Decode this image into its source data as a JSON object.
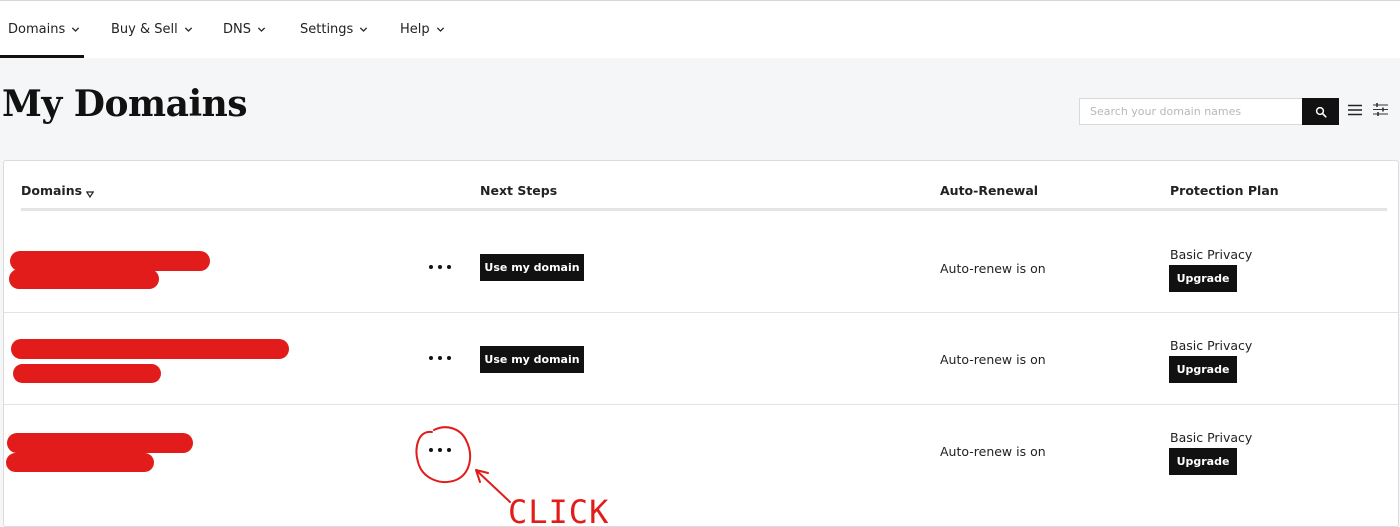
{
  "nav": {
    "items": [
      {
        "label": "Domains"
      },
      {
        "label": "Buy & Sell"
      },
      {
        "label": "DNS"
      },
      {
        "label": "Settings"
      },
      {
        "label": "Help"
      }
    ]
  },
  "header": {
    "title": "My Domains",
    "search_placeholder": "Search your domain names"
  },
  "table": {
    "columns": {
      "domains": "Domains",
      "next_steps": "Next Steps",
      "auto_renewal": "Auto-Renewal",
      "protection_plan": "Protection Plan"
    },
    "rows": [
      {
        "use_label": "Use my domain",
        "renewal": "Auto-renew is on",
        "plan": "Basic Privacy",
        "upgrade_label": "Upgrade"
      },
      {
        "use_label": "Use my domain",
        "renewal": "Auto-renew is on",
        "plan": "Basic Privacy",
        "upgrade_label": "Upgrade"
      },
      {
        "use_label": "",
        "renewal": "Auto-renew is on",
        "plan": "Basic Privacy",
        "upgrade_label": "Upgrade"
      }
    ]
  },
  "annotation": {
    "text": "CLICK",
    "color": "#e21b1b"
  },
  "colors": {
    "redaction": "#e21b1b",
    "button_bg": "#111111",
    "page_bg": "#f5f6f7"
  }
}
